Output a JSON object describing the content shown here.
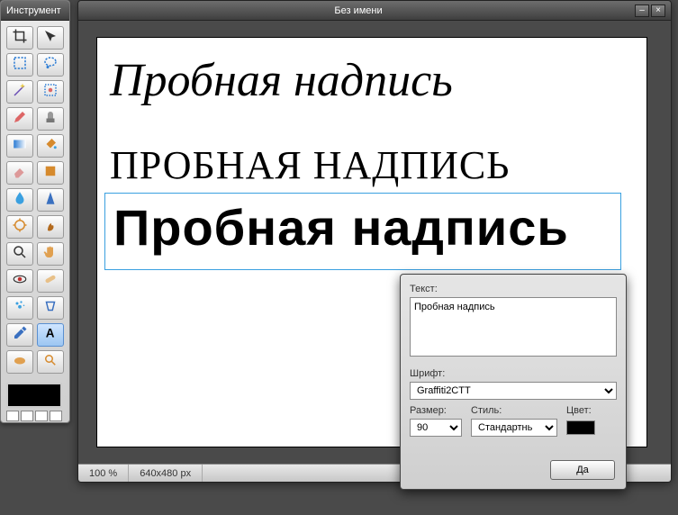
{
  "toolbox": {
    "title": "Инструмент",
    "tools": [
      {
        "name": "crop-icon",
        "color": "#333"
      },
      {
        "name": "move-icon",
        "color": "#333"
      },
      {
        "name": "rect-select-icon",
        "color": "#2a7bd4"
      },
      {
        "name": "lasso-icon",
        "color": "#2a7bd4"
      },
      {
        "name": "magic-wand-icon",
        "color": "#6b4fb5"
      },
      {
        "name": "color-select-icon",
        "color": "#2a7bd4"
      },
      {
        "name": "pencil-icon",
        "color": "#d66"
      },
      {
        "name": "clone-stamp-icon",
        "color": "#777"
      },
      {
        "name": "gradient-icon",
        "color": "#2a7bd4"
      },
      {
        "name": "bucket-fill-icon",
        "color": "#d68a2d"
      },
      {
        "name": "eraser-icon",
        "color": "#d66"
      },
      {
        "name": "shape-icon",
        "color": "#d68a2d"
      },
      {
        "name": "blur-icon",
        "color": "#3aa0e0"
      },
      {
        "name": "sharpen-icon",
        "color": "#3a70c0"
      },
      {
        "name": "dodge-icon",
        "color": "#d68a2d"
      },
      {
        "name": "burn-icon",
        "color": "#b36a1d"
      },
      {
        "name": "zoom-icon",
        "color": "#333"
      },
      {
        "name": "hand-icon",
        "color": "#e0a050"
      },
      {
        "name": "redeye-icon",
        "color": "#c03030"
      },
      {
        "name": "healing-icon",
        "color": "#d68a2d"
      },
      {
        "name": "airbrush-icon",
        "color": "#3aa0e0"
      },
      {
        "name": "perspective-icon",
        "color": "#3a70c0"
      },
      {
        "name": "eyedropper-icon",
        "color": "#3a70c0"
      },
      {
        "name": "text-icon",
        "color": "#000"
      },
      {
        "name": "sponge-icon",
        "color": "#e0a050"
      },
      {
        "name": "search-icon",
        "color": "#d68a2d"
      }
    ],
    "selected_index": 23,
    "swatch_fg": "#000000",
    "swatch_minis": [
      "#fff",
      "#fff",
      "#fff",
      "#fff"
    ]
  },
  "document": {
    "title": "Без имени",
    "zoom": "100 %",
    "dimensions": "640x480 px",
    "sample_text_1": "Пробная  надпись",
    "sample_text_2": "ПРОБНАЯ НАДПИСЬ",
    "sample_text_3": "Пробная надпись"
  },
  "text_dialog": {
    "text_label": "Текст:",
    "text_value": "Пробная надпись",
    "font_label": "Шрифт:",
    "font_value": "Graffiti2CTT",
    "size_label": "Размер:",
    "size_value": "90",
    "style_label": "Стиль:",
    "style_value": "Стандартнь",
    "color_label": "Цвет:",
    "color_value": "#000000",
    "ok_label": "Да"
  }
}
